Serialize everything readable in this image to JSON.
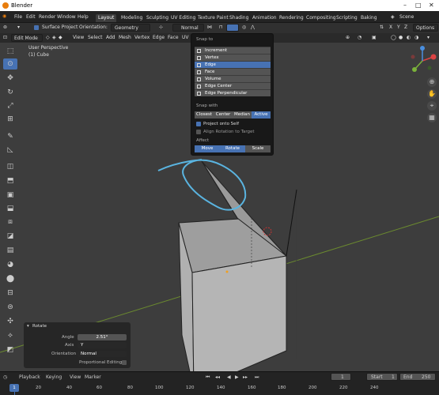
{
  "window": {
    "title": "Blender"
  },
  "menu": [
    "File",
    "Edit",
    "Render",
    "Window",
    "Help"
  ],
  "workspaces": [
    "Layout",
    "Modeling",
    "Sculpting",
    "UV Editing",
    "Texture Paint",
    "Shading",
    "Animation",
    "Rendering",
    "Compositing",
    "Scripting",
    "Baking"
  ],
  "scene": "Scene",
  "header1": {
    "surface_project": "Surface Project",
    "orientation_label": "Orientation:",
    "orientation_value": "Geometry",
    "pivot": "Normal",
    "options": "Options"
  },
  "header2": {
    "mode": "Edit Mode",
    "items": [
      "View",
      "Select",
      "Add",
      "Mesh",
      "Vertex",
      "Edge",
      "Face",
      "UV"
    ]
  },
  "viewport": {
    "line1": "User Perspective",
    "line2": "(1) Cube"
  },
  "snap_popup": {
    "snap_to_label": "Snap to",
    "snap_to": [
      "Increment",
      "Vertex",
      "Edge",
      "Face",
      "Volume",
      "Edge Center",
      "Edge Perpendicular"
    ],
    "selected": "Edge",
    "snap_with_label": "Snap with",
    "snap_with": [
      "Closest",
      "Center",
      "Median",
      "Active"
    ],
    "snap_with_selected": "Active",
    "project_self": "Project onto Self",
    "align_rotation": "Align Rotation to Target",
    "affect_label": "Affect",
    "affect": [
      "Move",
      "Rotate",
      "Scale"
    ]
  },
  "operator": {
    "title": "Rotate",
    "angle_label": "Angle",
    "angle_value": "2.51°",
    "axis_label": "Axis",
    "axis_value": "Y",
    "orientation_label": "Orientation",
    "orientation_value": "Normal",
    "proportional": "Proportional Editing"
  },
  "timeline": {
    "menus": [
      "Playback",
      "Keying",
      "View",
      "Marker"
    ],
    "current_frame": "1",
    "start_label": "Start",
    "start": "1",
    "end_label": "End",
    "end": "250",
    "ticks": [
      "1",
      "20",
      "40",
      "60",
      "80",
      "100",
      "120",
      "140",
      "160",
      "180",
      "200",
      "220",
      "240"
    ]
  },
  "colors": {
    "accent": "#4772b3",
    "annotation": "#5ab4e0",
    "bg": "#3d3d3d"
  }
}
